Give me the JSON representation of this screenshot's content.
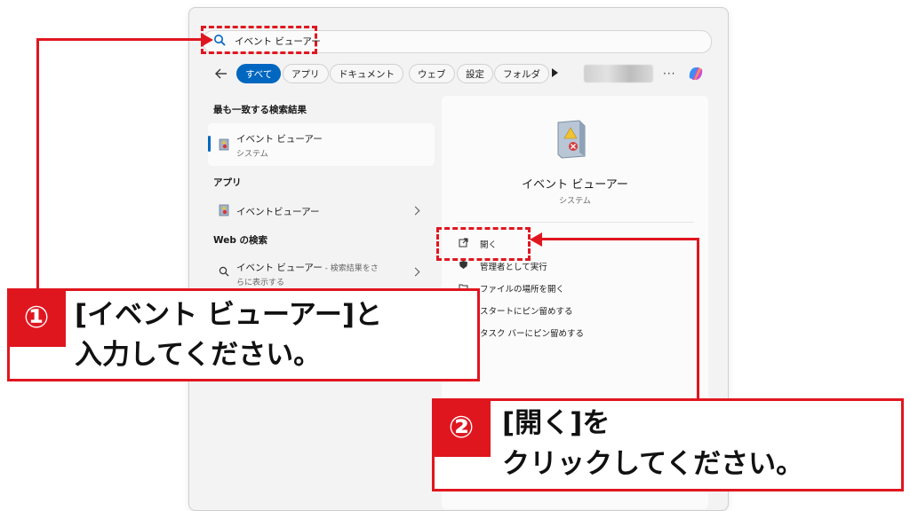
{
  "search": {
    "query": "イベント ビューアー"
  },
  "tabs": [
    {
      "label": "すべて",
      "active": true
    },
    {
      "label": "アプリ"
    },
    {
      "label": "ドキュメント"
    },
    {
      "label": "ウェブ"
    },
    {
      "label": "設定"
    },
    {
      "label": "フォルダ"
    }
  ],
  "more_label": "···",
  "left": {
    "best_match_heading": "最も一致する検索結果",
    "best_match": {
      "title": "イベント ビューアー",
      "subtitle": "システム"
    },
    "apps_heading": "アプリ",
    "app_item": "イベントビューアー",
    "web_heading": "Web の検索",
    "web_item_title": "イベント ビューアー",
    "web_item_suffix": " - 検索結果をさ",
    "web_item_line2": "らに表示する"
  },
  "right": {
    "title": "イベント ビューアー",
    "subtitle": "システム",
    "actions": [
      "開く",
      "管理者として実行",
      "ファイルの場所を開く",
      "スタートにピン留めする",
      "タスク バーにピン留めする"
    ]
  },
  "callouts": {
    "one": {
      "badge": "①",
      "line1": "[イベント ビューアー]と",
      "line2": "入力してください。"
    },
    "two": {
      "badge": "②",
      "line1": "[開く]を",
      "line2": "クリックしてください。"
    }
  },
  "colors": {
    "accent": "#0067c0",
    "annotation": "#e0161f"
  }
}
